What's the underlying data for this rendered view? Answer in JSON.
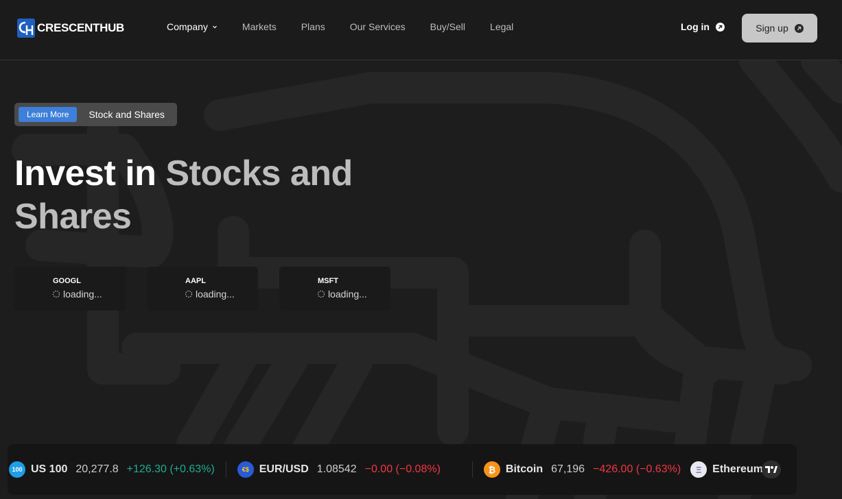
{
  "header": {
    "logo_text": "CRESCENTHUB",
    "nav": [
      {
        "label": "Company",
        "active": true,
        "has_dropdown": true
      },
      {
        "label": "Markets"
      },
      {
        "label": "Plans"
      },
      {
        "label": "Our Services"
      },
      {
        "label": "Buy/Sell"
      },
      {
        "label": "Legal"
      }
    ],
    "login_label": "Log in",
    "signup_label": "Sign up"
  },
  "hero": {
    "pill_button": "Learn More",
    "pill_text": "Stock and Shares",
    "headline_white": "Invest in ",
    "headline_gray": "Stocks and Shares"
  },
  "cards": [
    {
      "symbol": "GOOGL",
      "status": "loading..."
    },
    {
      "symbol": "AAPL",
      "status": "loading..."
    },
    {
      "symbol": "MSFT",
      "status": "loading..."
    }
  ],
  "ticker": [
    {
      "icon_text": "100",
      "icon_color": "#1e9ee6",
      "name": "US 100",
      "value": "20,277.8",
      "change": "+126.30 (+0.63%)",
      "direction": "up"
    },
    {
      "icon_text": "€$",
      "icon_color": "#2a5bd7",
      "name": "EUR/USD",
      "value": "1.08542",
      "change": "−0.00 (−0.08%)",
      "direction": "down"
    },
    {
      "icon_text": "₿",
      "icon_color": "#f7931a",
      "name": "Bitcoin",
      "value": "67,196",
      "change": "−426.00 (−0.63%)",
      "direction": "down"
    },
    {
      "icon_text": "Ξ",
      "icon_color": "#e9e9f2",
      "name": "Ethereum",
      "value": "",
      "change": "",
      "direction": "up"
    }
  ],
  "colors": {
    "accent": "#3d7fd9",
    "up": "#22ab94",
    "down": "#f23645"
  }
}
